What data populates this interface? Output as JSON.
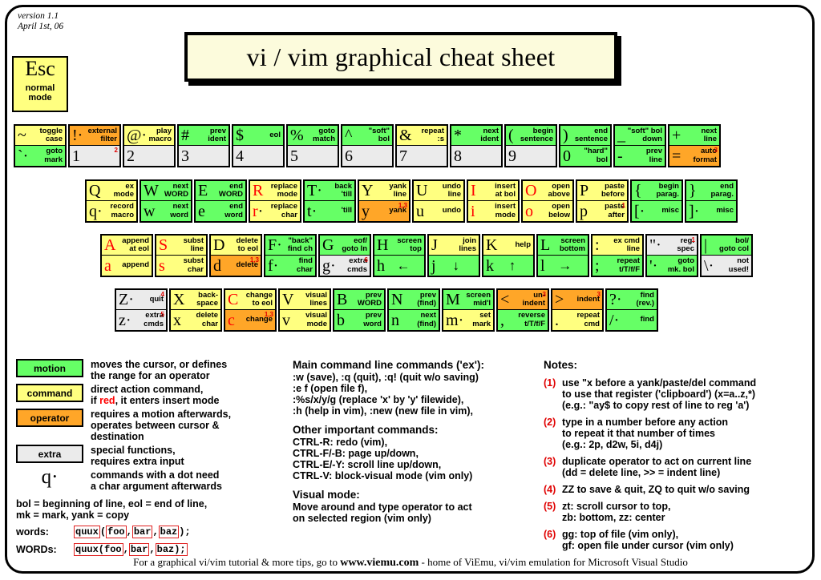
{
  "meta": {
    "version": "version 1.1",
    "date": "April 1st, 06"
  },
  "title": "vi / vim graphical cheat sheet",
  "esc": {
    "glyph": "Esc",
    "label": "normal\nmode"
  },
  "colors": {
    "motion": "#66ff66",
    "command": "#ffff80",
    "operator": "#ffa628",
    "extra": "#ebebeb",
    "red": "#ff0000",
    "note_red": "#e00000",
    "title_bg": "#fcfbdc"
  },
  "rows": {
    "numbers": [
      {
        "top": {
          "glyph": "~",
          "label": "toggle\ncase",
          "type": "command"
        },
        "bot": {
          "glyph": "`",
          "dot": true,
          "label": "goto\nmark",
          "type": "motion"
        }
      },
      {
        "top": {
          "glyph": "!",
          "dot": true,
          "label": "external\nfilter",
          "type": "operator"
        },
        "bot": {
          "glyph": "1",
          "label": "",
          "type": "extra",
          "sup": "2"
        }
      },
      {
        "top": {
          "glyph": "@",
          "dot": true,
          "label": "play\nmacro",
          "type": "command"
        },
        "bot": {
          "glyph": "2",
          "label": "",
          "type": "extra"
        }
      },
      {
        "top": {
          "glyph": "#",
          "label": "prev\nident",
          "type": "motion"
        },
        "bot": {
          "glyph": "3",
          "label": "",
          "type": "extra"
        }
      },
      {
        "top": {
          "glyph": "$",
          "label": "eol",
          "type": "motion"
        },
        "bot": {
          "glyph": "4",
          "label": "",
          "type": "extra"
        }
      },
      {
        "top": {
          "glyph": "%",
          "label": "goto\nmatch",
          "type": "motion"
        },
        "bot": {
          "glyph": "5",
          "label": "",
          "type": "extra"
        }
      },
      {
        "top": {
          "glyph": "^",
          "label": "\"soft\"\nbol",
          "type": "motion"
        },
        "bot": {
          "glyph": "6",
          "label": "",
          "type": "extra"
        }
      },
      {
        "top": {
          "glyph": "&",
          "label": "repeat\n:s",
          "type": "command"
        },
        "bot": {
          "glyph": "7",
          "label": "",
          "type": "extra"
        }
      },
      {
        "top": {
          "glyph": "*",
          "label": "next\nident",
          "type": "motion"
        },
        "bot": {
          "glyph": "8",
          "label": "",
          "type": "extra"
        }
      },
      {
        "top": {
          "glyph": "(",
          "label": "begin\nsentence",
          "type": "motion"
        },
        "bot": {
          "glyph": "9",
          "label": "",
          "type": "extra"
        }
      },
      {
        "top": {
          "glyph": ")",
          "label": "end\nsentence",
          "type": "motion"
        },
        "bot": {
          "glyph": "0",
          "label": "\"hard\"\nbol",
          "type": "motion"
        }
      },
      {
        "top": {
          "glyph": "_",
          "label": "\"soft\" bol\ndown",
          "type": "motion"
        },
        "bot": {
          "glyph": "-",
          "label": "prev\nline",
          "type": "motion"
        }
      },
      {
        "top": {
          "glyph": "+",
          "label": "next\nline",
          "type": "motion"
        },
        "bot": {
          "glyph": "=",
          "label": "auto\nformat",
          "type": "operator",
          "sup": "3"
        }
      }
    ],
    "qwerty": [
      {
        "top": {
          "glyph": "Q",
          "label": "ex\nmode",
          "type": "command"
        },
        "bot": {
          "glyph": "q",
          "dot": true,
          "label": "record\nmacro",
          "type": "command"
        }
      },
      {
        "top": {
          "glyph": "W",
          "label": "next\nWORD",
          "type": "motion"
        },
        "bot": {
          "glyph": "w",
          "label": "next\nword",
          "type": "motion"
        }
      },
      {
        "top": {
          "glyph": "E",
          "label": "end\nWORD",
          "type": "motion"
        },
        "bot": {
          "glyph": "e",
          "label": "end\nword",
          "type": "motion"
        }
      },
      {
        "top": {
          "glyph": "R",
          "label": "replace\nmode",
          "type": "command",
          "red": true
        },
        "bot": {
          "glyph": "r",
          "dot": true,
          "label": "replace\nchar",
          "type": "command",
          "red": true
        }
      },
      {
        "top": {
          "glyph": "T",
          "dot": true,
          "label": "back\n'till",
          "type": "motion"
        },
        "bot": {
          "glyph": "t",
          "dot": true,
          "label": "'till",
          "type": "motion"
        }
      },
      {
        "top": {
          "glyph": "Y",
          "label": "yank\nline",
          "type": "command"
        },
        "bot": {
          "glyph": "y",
          "label": "yank",
          "type": "operator",
          "sup": "1,3"
        }
      },
      {
        "top": {
          "glyph": "U",
          "label": "undo\nline",
          "type": "command"
        },
        "bot": {
          "glyph": "u",
          "label": "undo",
          "type": "command"
        }
      },
      {
        "top": {
          "glyph": "I",
          "label": "insert\nat bol",
          "type": "command",
          "red": true
        },
        "bot": {
          "glyph": "i",
          "label": "insert\nmode",
          "type": "command",
          "red": true
        }
      },
      {
        "top": {
          "glyph": "O",
          "label": "open\nabove",
          "type": "command",
          "red": true
        },
        "bot": {
          "glyph": "o",
          "label": "open\nbelow",
          "type": "command",
          "red": true
        }
      },
      {
        "top": {
          "glyph": "P",
          "label": "paste\nbefore",
          "type": "command"
        },
        "bot": {
          "glyph": "p",
          "label": "paste\nafter",
          "type": "command",
          "sup": "1"
        }
      },
      {
        "top": {
          "glyph": "{",
          "label": "begin\nparag.",
          "type": "motion"
        },
        "bot": {
          "glyph": "[",
          "dot": true,
          "label": "misc",
          "type": "motion"
        }
      },
      {
        "top": {
          "glyph": "}",
          "label": "end\nparag.",
          "type": "motion"
        },
        "bot": {
          "glyph": "]",
          "dot": true,
          "label": "misc",
          "type": "motion"
        }
      }
    ],
    "home": [
      {
        "top": {
          "glyph": "A",
          "label": "append\nat eol",
          "type": "command",
          "red": true
        },
        "bot": {
          "glyph": "a",
          "label": "append",
          "type": "command",
          "red": true
        }
      },
      {
        "top": {
          "glyph": "S",
          "label": "subst\nline",
          "type": "command",
          "red": true
        },
        "bot": {
          "glyph": "s",
          "label": "subst\nchar",
          "type": "command",
          "red": true
        }
      },
      {
        "top": {
          "glyph": "D",
          "label": "delete\nto eol",
          "type": "command"
        },
        "bot": {
          "glyph": "d",
          "label": "delete",
          "type": "operator",
          "sup": "1,3"
        }
      },
      {
        "top": {
          "glyph": "F",
          "dot": true,
          "label": "\"back\"\nfind ch",
          "type": "motion"
        },
        "bot": {
          "glyph": "f",
          "dot": true,
          "label": "find\nchar",
          "type": "motion"
        }
      },
      {
        "top": {
          "glyph": "G",
          "label": "eof/\ngoto ln",
          "type": "motion"
        },
        "bot": {
          "glyph": "g",
          "dot": true,
          "label": "extra\ncmds",
          "type": "extra",
          "sup": "6"
        }
      },
      {
        "top": {
          "glyph": "H",
          "label": "screen\ntop",
          "type": "motion"
        },
        "bot": {
          "glyph": "h",
          "label": "←",
          "type": "motion",
          "arrow": true
        }
      },
      {
        "top": {
          "glyph": "J",
          "label": "join\nlines",
          "type": "command"
        },
        "bot": {
          "glyph": "j",
          "label": "↓",
          "type": "motion",
          "arrow": true
        }
      },
      {
        "top": {
          "glyph": "K",
          "label": "help",
          "type": "command"
        },
        "bot": {
          "glyph": "k",
          "label": "↑",
          "type": "motion",
          "arrow": true
        }
      },
      {
        "top": {
          "glyph": "L",
          "label": "screen\nbottom",
          "type": "motion"
        },
        "bot": {
          "glyph": "l",
          "label": "→",
          "type": "motion",
          "arrow": true
        }
      },
      {
        "top": {
          "glyph": ":",
          "label": "ex cmd\nline",
          "type": "command"
        },
        "bot": {
          "glyph": ";",
          "label": "repeat\nt/T/f/F",
          "type": "motion"
        }
      },
      {
        "top": {
          "glyph": "\"",
          "dot": true,
          "label": "reg.\nspec",
          "type": "extra",
          "sup": "1"
        },
        "bot": {
          "glyph": "'",
          "dot": true,
          "label": "goto\nmk. bol",
          "type": "motion"
        }
      },
      {
        "top": {
          "glyph": "|",
          "label": "bol/\ngoto col",
          "type": "motion"
        },
        "bot": {
          "glyph": "\\",
          "dot": true,
          "label": "not\nused!",
          "type": "extra"
        }
      }
    ],
    "bottom": [
      {
        "top": {
          "glyph": "Z",
          "dot": true,
          "label": "quit",
          "type": "extra",
          "sup": "4"
        },
        "bot": {
          "glyph": "z",
          "dot": true,
          "label": "extra\ncmds",
          "type": "extra",
          "sup": "5"
        }
      },
      {
        "top": {
          "glyph": "X",
          "label": "back-\nspace",
          "type": "command"
        },
        "bot": {
          "glyph": "x",
          "label": "delete\nchar",
          "type": "command"
        }
      },
      {
        "top": {
          "glyph": "C",
          "label": "change\nto eol",
          "type": "command",
          "red": true
        },
        "bot": {
          "glyph": "c",
          "label": "change",
          "type": "operator",
          "red": true,
          "sup": "1,3"
        }
      },
      {
        "top": {
          "glyph": "V",
          "label": "visual\nlines",
          "type": "command"
        },
        "bot": {
          "glyph": "v",
          "label": "visual\nmode",
          "type": "command"
        }
      },
      {
        "top": {
          "glyph": "B",
          "label": "prev\nWORD",
          "type": "motion"
        },
        "bot": {
          "glyph": "b",
          "label": "prev\nword",
          "type": "motion"
        }
      },
      {
        "top": {
          "glyph": "N",
          "label": "prev\n(find)",
          "type": "motion"
        },
        "bot": {
          "glyph": "n",
          "label": "next\n(find)",
          "type": "motion"
        }
      },
      {
        "top": {
          "glyph": "M",
          "label": "screen\nmid'l",
          "type": "motion"
        },
        "bot": {
          "glyph": "m",
          "dot": true,
          "label": "set\nmark",
          "type": "command"
        }
      },
      {
        "top": {
          "glyph": "<",
          "label": "un-\nindent",
          "type": "operator",
          "sup": "3"
        },
        "bot": {
          "glyph": ",",
          "label": "reverse\nt/T/f/F",
          "type": "motion"
        }
      },
      {
        "top": {
          "glyph": ">",
          "label": "indent",
          "type": "operator",
          "sup": "3"
        },
        "bot": {
          "glyph": ".",
          "label": "repeat\ncmd",
          "type": "command"
        }
      },
      {
        "top": {
          "glyph": "?",
          "dot": true,
          "label": "find\n(rev.)",
          "type": "motion"
        },
        "bot": {
          "glyph": "/",
          "dot": true,
          "label": "find",
          "type": "motion"
        }
      }
    ]
  },
  "legend": {
    "items": [
      {
        "chip": "motion",
        "type": "motion",
        "text": "moves the cursor, or defines\nthe range for an operator"
      },
      {
        "chip": "command",
        "type": "command",
        "text": "direct action command,\nif red, it enters insert mode",
        "red_word": "red"
      },
      {
        "chip": "operator",
        "type": "operator",
        "text": "requires a motion afterwards,\noperates between cursor  &\ndestination"
      },
      {
        "chip": "extra",
        "type": "extra",
        "text": "special functions,\nrequires extra input"
      }
    ],
    "dot_glyph": "q·",
    "dot_text": "commands with a dot need\na char argument afterwards",
    "abbrev": "bol = beginning of line, eol = end of line,\nmk = mark, yank = copy",
    "words_label": "words:",
    "words_parts": [
      "quux",
      "(",
      "foo",
      ",",
      "bar",
      ",",
      "baz",
      ")",
      ";"
    ],
    "WORDs_label": "WORDs:",
    "WORDs_parts": [
      "quux(foo",
      ",",
      "bar",
      ",",
      "baz);"
    ]
  },
  "middle": {
    "ex_heading": "Main command line commands ('ex'):",
    "ex_lines": ":w (save), :q (quit), :q! (quit w/o saving)\n:e f (open file f),\n:%s/x/y/g (replace 'x' by 'y' filewide),\n:h (help in vim), :new (new file in vim),",
    "other_heading": "Other important commands:",
    "other_lines": "CTRL-R: redo (vim),\nCTRL-F/-B: page up/down,\nCTRL-E/-Y: scroll line up/down,\nCTRL-V: block-visual mode (vim only)",
    "visual_heading": "Visual mode:",
    "visual_lines": "Move around and type operator to act\non selected region (vim only)"
  },
  "notes": {
    "heading": "Notes:",
    "items": [
      {
        "num": "(1)",
        "text": "use \"x before a yank/paste/del command\nto use that register ('clipboard') (x=a..z,*)\n(e.g.: \"ay$ to copy rest of line to reg 'a')"
      },
      {
        "num": "(2)",
        "text": "type in a number before any action\nto repeat it that number of times\n(e.g.: 2p, d2w, 5i, d4j)"
      },
      {
        "num": "(3)",
        "text": "duplicate operator to act on current line\n(dd = delete line, >> = indent line)"
      },
      {
        "num": "(4)",
        "text": "ZZ to save & quit, ZQ to quit w/o saving"
      },
      {
        "num": "(5)",
        "text": "zt: scroll cursor to top,\nzb: bottom, zz: center"
      },
      {
        "num": "(6)",
        "text": "gg: top of file (vim only),\ngf: open file under cursor (vim only)"
      }
    ]
  },
  "footer": {
    "pre": "For a graphical vi/vim tutorial & more tips, go to",
    "url": "www.viemu.com",
    "post": "- home of ViEmu, vi/vim emulation for Microsoft Visual Studio"
  }
}
